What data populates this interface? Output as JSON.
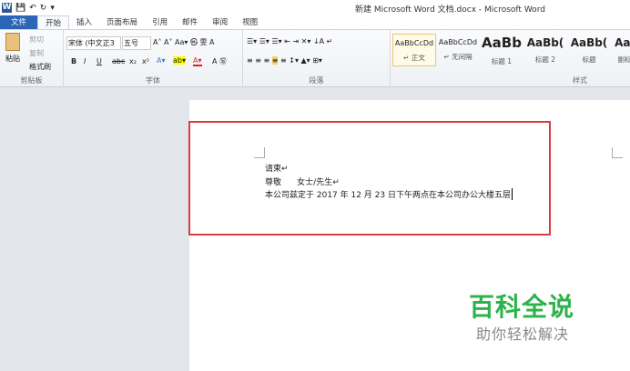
{
  "window": {
    "title": "新建 Microsoft Word 文档.docx - Microsoft Word",
    "quick_access": [
      "W",
      "💾",
      "↶",
      "↻",
      "▾"
    ]
  },
  "tabs": [
    "文件",
    "开始",
    "插入",
    "页面布局",
    "引用",
    "邮件",
    "审阅",
    "视图"
  ],
  "clipboard": {
    "paste": "粘贴",
    "cut": "剪切",
    "copy": "复制",
    "format_painter": "格式刷",
    "label": "剪贴板"
  },
  "font": {
    "name": "宋体 (中文正3",
    "size": "五号",
    "label": "字体",
    "buttons": [
      "B",
      "I",
      "U",
      "abc",
      "x₂",
      "x²"
    ]
  },
  "paragraph": {
    "label": "段落"
  },
  "styles": {
    "label": "样式",
    "items": [
      {
        "sample": "AaBbCcDd",
        "name": "↵ 正文"
      },
      {
        "sample": "AaBbCcDd",
        "name": "↵ 无间隔"
      },
      {
        "sample": "AaBb",
        "name": "标题 1"
      },
      {
        "sample": "AaBb(",
        "name": "标题 2"
      },
      {
        "sample": "AaBb(",
        "name": "标题"
      },
      {
        "sample": "AaI",
        "name": "副标"
      }
    ]
  },
  "document": {
    "lines": [
      "请柬↵",
      "尊敬      女士/先生↵",
      "本公司兹定于 2017 年 12 月 23 日下午两点在本公司办公大楼五层"
    ]
  },
  "watermark": {
    "title": "百科全说",
    "subtitle": "助你轻松解决"
  }
}
